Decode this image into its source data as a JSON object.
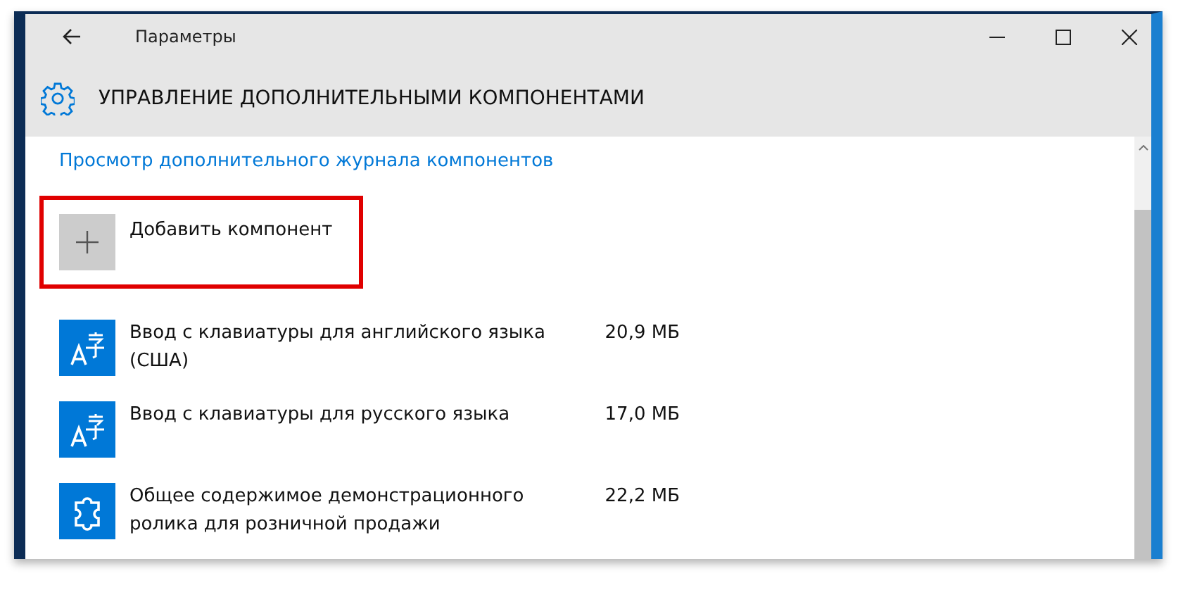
{
  "window": {
    "title": "Параметры"
  },
  "header": {
    "title": "УПРАВЛЕНИЕ ДОПОЛНИТЕЛЬНЫМИ КОМПОНЕНТАМИ"
  },
  "history_link": "Просмотр дополнительного журнала компонентов",
  "add_button": {
    "label": "Добавить компонент",
    "highlighted": true
  },
  "components": [
    {
      "kind": "language",
      "name": "Ввод с клавиатуры для английского языка (США)",
      "size": "20,9 МБ"
    },
    {
      "kind": "language",
      "name": "Ввод с клавиатуры для русского языка",
      "size": "17,0 МБ"
    },
    {
      "kind": "feature",
      "name": "Общее содержимое демонстрационного ролика для розничной продажи",
      "size": "22,2 МБ"
    }
  ]
}
